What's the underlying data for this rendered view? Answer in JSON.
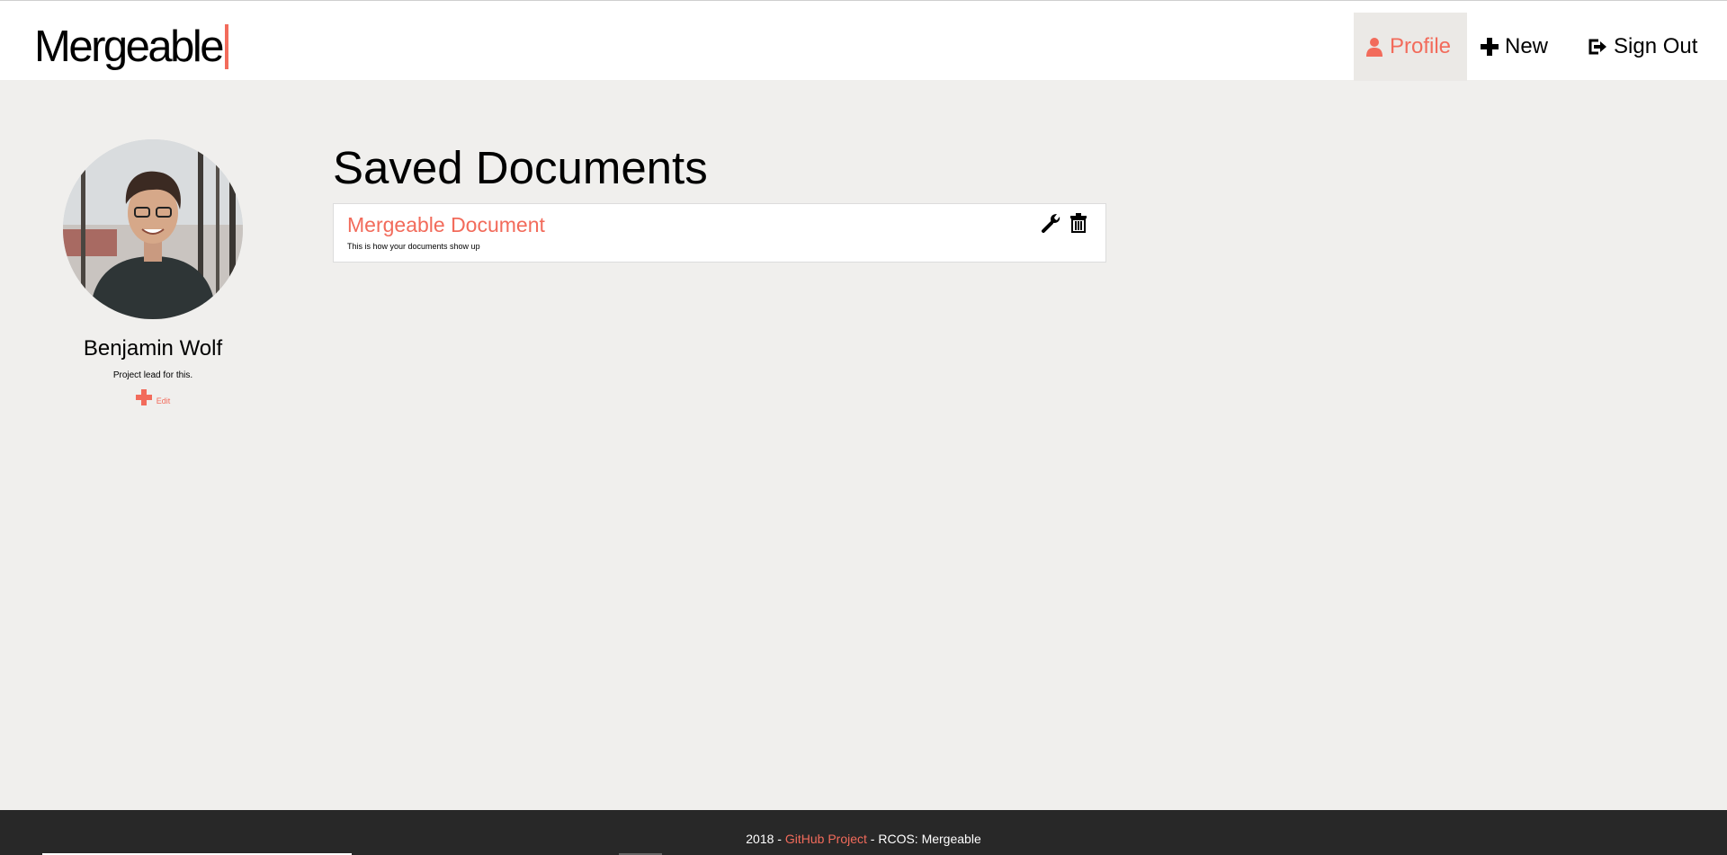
{
  "header": {
    "logo_text": "Mergeable",
    "nav": [
      {
        "label": "Profile",
        "icon": "user-icon",
        "active": true
      },
      {
        "label": "New",
        "icon": "plus-icon",
        "active": false
      },
      {
        "label": "Sign Out",
        "icon": "sign-out-icon",
        "active": false
      }
    ]
  },
  "profile": {
    "name": "Benjamin Wolf",
    "bio": "Project lead for this.",
    "edit_label": "Edit"
  },
  "main": {
    "title": "Saved Documents",
    "documents": [
      {
        "title": "Mergeable Document",
        "description": "This is how your documents show up",
        "actions": [
          "wrench-icon",
          "trash-icon"
        ]
      }
    ]
  },
  "footer": {
    "prefix": "2018 - ",
    "link_label": "GitHub Project",
    "suffix": " - RCOS: Mergeable"
  },
  "colors": {
    "accent": "#f26b5b",
    "background": "#f0efed",
    "footer_bg": "#282828",
    "active_nav_bg": "#ebe9e6"
  }
}
